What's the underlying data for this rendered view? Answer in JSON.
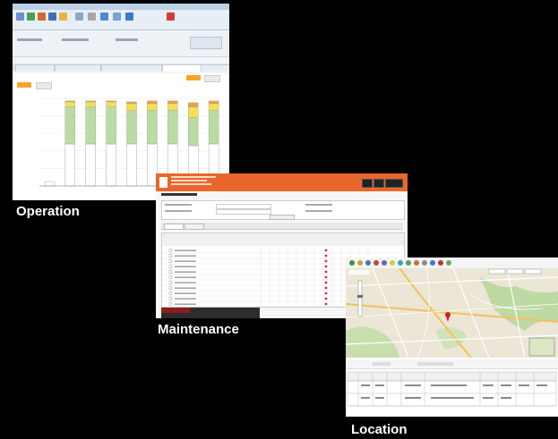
{
  "captions": {
    "operation": "Operation",
    "maintenance": "Maintenance",
    "location": "Location"
  },
  "colors": {
    "bar_green": "#b9dca2",
    "bar_yellow": "#f3e05a",
    "bar_orange": "#f0a23a",
    "maintenance_header": "#e9672c"
  },
  "operation_window": {
    "chart_data": {
      "type": "bar",
      "categories": [
        "",
        "",
        "",
        "",
        "",
        "",
        "",
        "",
        ""
      ],
      "series": [
        {
          "name": "",
          "values": [
            5,
            48,
            48,
            48,
            48,
            48,
            48,
            46,
            48
          ]
        },
        {
          "name": "",
          "values": [
            0,
            42,
            42,
            42,
            38,
            38,
            38,
            32,
            38
          ]
        },
        {
          "name": "",
          "values": [
            0,
            6,
            6,
            6,
            8,
            8,
            8,
            12,
            8
          ]
        },
        {
          "name": "",
          "values": [
            0,
            1,
            1,
            1,
            2,
            3,
            3,
            5,
            3
          ]
        }
      ],
      "ylim": [
        0,
        100
      ],
      "grid": true
    }
  },
  "maintenance_window": {
    "rows": 11
  },
  "location_window": {
    "rows": 2
  }
}
